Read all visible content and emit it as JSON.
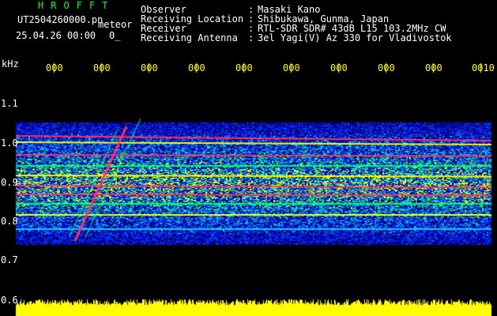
{
  "header": {
    "brand": "HROFFT",
    "filename": "UT2504260000.pn",
    "tag": "meteor",
    "date": "25.04.26 00:00",
    "counter": "0_",
    "info": [
      {
        "label": "Observer",
        "value": "Masaki Kano"
      },
      {
        "label": "Receiving Location",
        "value": "Shibukawa, Gunma, Japan"
      },
      {
        "label": "Receiver",
        "value": "RTL-SDR SDR# 43dB L15 103.2MHz CW"
      },
      {
        "label": "Receiving Antenna",
        "value": "3el Yagi(V) Az 330 for Vladivostok"
      }
    ]
  },
  "axes": {
    "unit": "kHz",
    "y_ticks": [
      "1.1",
      "1.0",
      "0.9",
      "0.8",
      "0.7",
      "0.6"
    ],
    "x_ticks": [
      "000",
      "000",
      "000",
      "000",
      "000",
      "000",
      "000",
      "000",
      "000",
      "0010"
    ]
  },
  "colors": {
    "text": "#ffffff",
    "brand": "#00ff00",
    "axis": "#ffff00",
    "background": "#000000",
    "spectrum_bg": "#00008b",
    "signal": "#ff3366",
    "noise_floor": "#ffff00"
  }
}
